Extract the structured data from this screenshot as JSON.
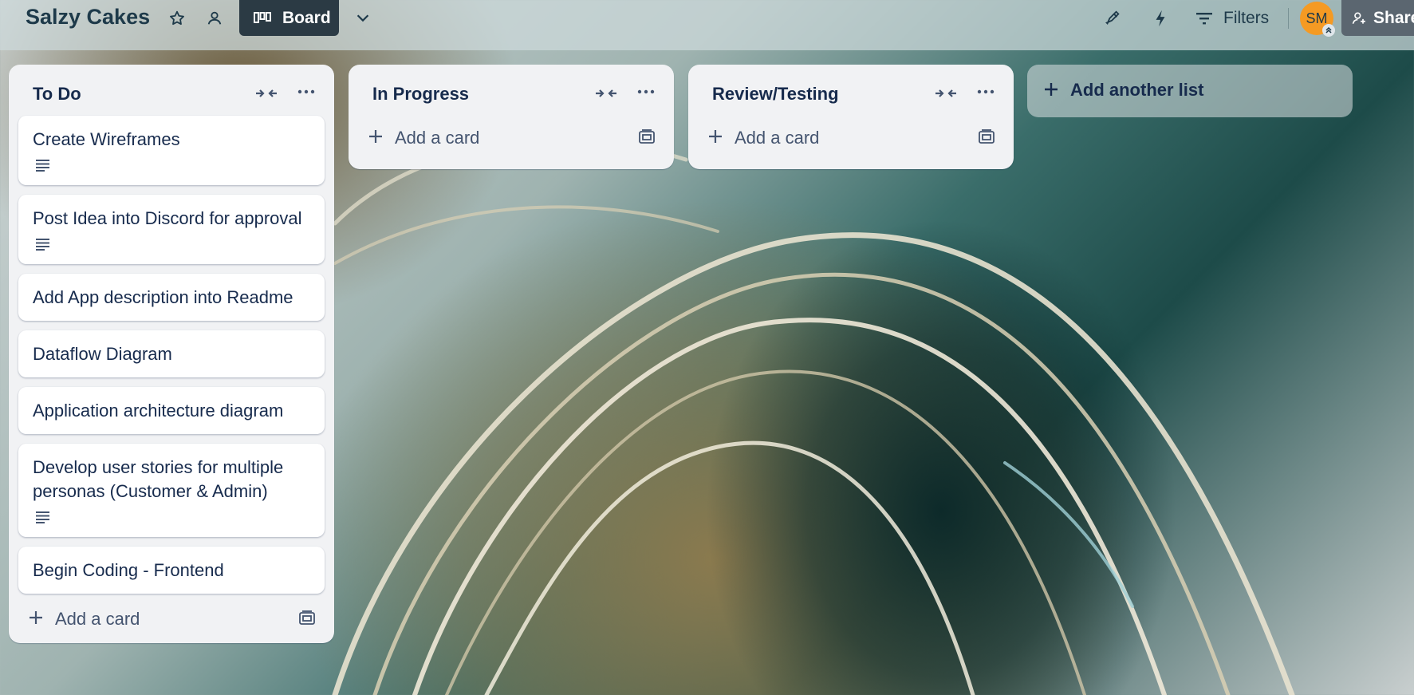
{
  "header": {
    "board_title": "Salzy Cakes",
    "view_label": "Board",
    "filters_label": "Filters",
    "avatar_initials": "SM",
    "share_label": "Share"
  },
  "lists": [
    {
      "title": "To Do",
      "cards": [
        {
          "title": "Create Wireframes",
          "has_description": true
        },
        {
          "title": "Post Idea into Discord for approval",
          "has_description": true
        },
        {
          "title": "Add App description into Readme",
          "has_description": false
        },
        {
          "title": "Dataflow Diagram",
          "has_description": false
        },
        {
          "title": "Application architecture diagram",
          "has_description": false
        },
        {
          "title": "Develop user stories for multiple personas (Customer & Admin)",
          "has_description": true
        },
        {
          "title": "Begin Coding - Frontend",
          "has_description": false
        }
      ],
      "add_card_label": "Add a card"
    },
    {
      "title": "In Progress",
      "cards": [],
      "add_card_label": "Add a card"
    },
    {
      "title": "Review/Testing",
      "cards": [],
      "add_card_label": "Add a card"
    }
  ],
  "add_list_label": "Add another list",
  "colors": {
    "header_bg": "#cddadb",
    "view_button_bg": "#2b3a44",
    "avatar_bg": "#f59a23",
    "share_bg": "#5b6670",
    "list_bg": "#f1f2f4",
    "text_primary": "#172b4d"
  },
  "icons": [
    "star-icon",
    "workspace-visibility-icon",
    "board-view-icon",
    "chevron-down-icon",
    "power-ups-icon",
    "automation-icon",
    "filter-icon",
    "share-person-icon",
    "collapse-list-icon",
    "more-icon",
    "description-icon",
    "plus-icon",
    "card-template-icon"
  ]
}
